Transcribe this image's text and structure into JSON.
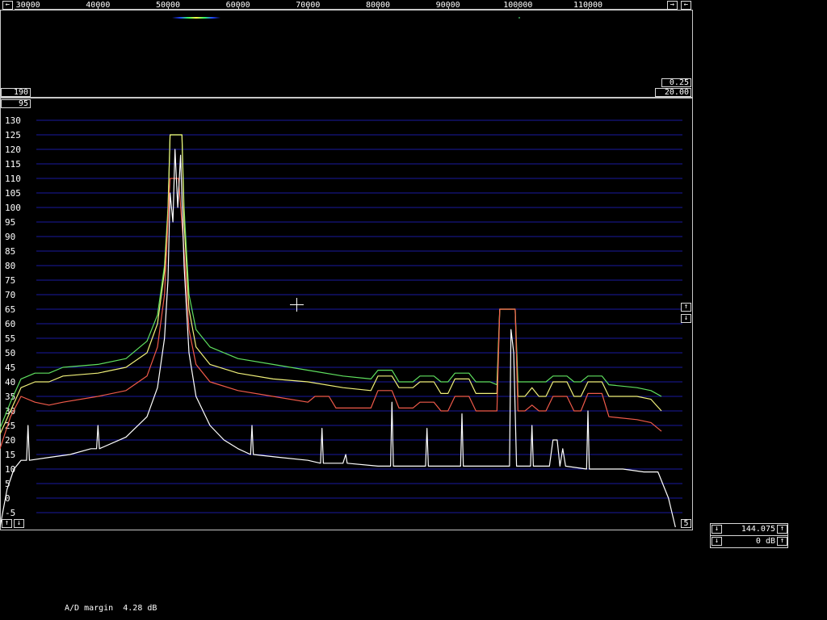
{
  "frequency_scale": {
    "labels": [
      "30000",
      "40000",
      "50000",
      "60000",
      "70000",
      "80000",
      "90000",
      "100000",
      "110000"
    ],
    "left_arrow": "←",
    "right_arrow": "→",
    "right_end_arrow": "←"
  },
  "waterfall": {
    "top_right_value": "0.25",
    "bottom_right_value": "20.00",
    "bottom_left_value": "190"
  },
  "spectrum": {
    "top_left_value": "95",
    "bottom_right_value": "5",
    "bottom_left_up": "↑",
    "bottom_left_down": "↓",
    "side_up": "↑",
    "side_down": "↓",
    "y_labels": [
      "130",
      "125",
      "120",
      "115",
      "110",
      "105",
      "100",
      "95",
      "90",
      "85",
      "80",
      "75",
      "70",
      "65",
      "60",
      "55",
      "50",
      "45",
      "40",
      "35",
      "30",
      "25",
      "20",
      "15",
      "10",
      "5",
      "0",
      "-5"
    ]
  },
  "side_panel": {
    "freq_value": "144.075",
    "gain_value": "0 dB",
    "down_arrow": "↓",
    "up_arrow": "↑"
  },
  "status_bar": {
    "ad_margin_label": "A/D margin",
    "ad_margin_value": "4.28 dB"
  },
  "colors": {
    "grid": "#1a1aa0",
    "green": "#5fe05f",
    "yellow": "#f0f07a",
    "red": "#f05a4a",
    "white": "#ffffff"
  },
  "chart_data": {
    "type": "line",
    "xlim": [
      26000,
      125000
    ],
    "ylim": [
      -10,
      133
    ],
    "y_ticks": [
      130,
      125,
      120,
      115,
      110,
      105,
      100,
      95,
      90,
      85,
      80,
      75,
      70,
      65,
      60,
      55,
      50,
      45,
      40,
      35,
      30,
      25,
      20,
      15,
      10,
      5,
      0,
      -5
    ],
    "series": [
      {
        "color_key": "green",
        "points": [
          [
            26000,
            24
          ],
          [
            27500,
            33
          ],
          [
            29000,
            41
          ],
          [
            31000,
            43
          ],
          [
            33000,
            43
          ],
          [
            35000,
            45
          ],
          [
            40000,
            46
          ],
          [
            44000,
            48
          ],
          [
            47000,
            54
          ],
          [
            48500,
            63
          ],
          [
            49500,
            80
          ],
          [
            50000,
            100
          ],
          [
            50300,
            125
          ],
          [
            52000,
            125
          ],
          [
            52300,
            100
          ],
          [
            53000,
            70
          ],
          [
            54000,
            58
          ],
          [
            56000,
            52
          ],
          [
            60000,
            48
          ],
          [
            65000,
            46
          ],
          [
            70000,
            44
          ],
          [
            75000,
            42
          ],
          [
            79000,
            41
          ],
          [
            80000,
            44
          ],
          [
            82000,
            44
          ],
          [
            83000,
            40
          ],
          [
            85000,
            40
          ],
          [
            86000,
            42
          ],
          [
            88000,
            42
          ],
          [
            89000,
            40
          ],
          [
            90000,
            40
          ],
          [
            91000,
            43
          ],
          [
            93000,
            43
          ],
          [
            94000,
            40
          ],
          [
            96000,
            40
          ],
          [
            97000,
            39
          ],
          [
            97400,
            65
          ],
          [
            99600,
            65
          ],
          [
            100000,
            40
          ],
          [
            101000,
            40
          ],
          [
            102000,
            40
          ],
          [
            103000,
            40
          ],
          [
            104000,
            40
          ],
          [
            105000,
            42
          ],
          [
            107000,
            42
          ],
          [
            108000,
            40
          ],
          [
            109000,
            40
          ],
          [
            110000,
            42
          ],
          [
            112000,
            42
          ],
          [
            113000,
            39
          ],
          [
            117000,
            38
          ],
          [
            119000,
            37
          ],
          [
            120500,
            35
          ]
        ]
      },
      {
        "color_key": "yellow",
        "points": [
          [
            26000,
            22
          ],
          [
            27500,
            30
          ],
          [
            29000,
            38
          ],
          [
            31000,
            40
          ],
          [
            33000,
            40
          ],
          [
            35000,
            42
          ],
          [
            40000,
            43
          ],
          [
            44000,
            45
          ],
          [
            47000,
            50
          ],
          [
            48500,
            60
          ],
          [
            49500,
            78
          ],
          [
            50000,
            98
          ],
          [
            50300,
            125
          ],
          [
            52000,
            125
          ],
          [
            52300,
            95
          ],
          [
            53000,
            65
          ],
          [
            54000,
            52
          ],
          [
            56000,
            46
          ],
          [
            60000,
            43
          ],
          [
            65000,
            41
          ],
          [
            70000,
            40
          ],
          [
            75000,
            38
          ],
          [
            79000,
            37
          ],
          [
            80000,
            42
          ],
          [
            82000,
            42
          ],
          [
            83000,
            38
          ],
          [
            85000,
            38
          ],
          [
            86000,
            40
          ],
          [
            88000,
            40
          ],
          [
            89000,
            36
          ],
          [
            90000,
            36
          ],
          [
            91000,
            41
          ],
          [
            93000,
            41
          ],
          [
            94000,
            36
          ],
          [
            96000,
            36
          ],
          [
            97000,
            36
          ],
          [
            97400,
            65
          ],
          [
            99600,
            65
          ],
          [
            100000,
            35
          ],
          [
            101000,
            35
          ],
          [
            102000,
            38
          ],
          [
            103000,
            35
          ],
          [
            104000,
            35
          ],
          [
            105000,
            40
          ],
          [
            107000,
            40
          ],
          [
            108000,
            35
          ],
          [
            109000,
            35
          ],
          [
            110000,
            40
          ],
          [
            112000,
            40
          ],
          [
            113000,
            35
          ],
          [
            117000,
            35
          ],
          [
            119000,
            34
          ],
          [
            120500,
            30
          ]
        ]
      },
      {
        "color_key": "red",
        "points": [
          [
            26000,
            17
          ],
          [
            27500,
            28
          ],
          [
            29000,
            35
          ],
          [
            31000,
            33
          ],
          [
            33000,
            32
          ],
          [
            35000,
            33
          ],
          [
            40000,
            35
          ],
          [
            44000,
            37
          ],
          [
            47000,
            42
          ],
          [
            48500,
            52
          ],
          [
            49500,
            70
          ],
          [
            50000,
            95
          ],
          [
            50300,
            110
          ],
          [
            51500,
            110
          ],
          [
            52300,
            85
          ],
          [
            53000,
            58
          ],
          [
            54000,
            46
          ],
          [
            56000,
            40
          ],
          [
            60000,
            37
          ],
          [
            65000,
            35
          ],
          [
            70000,
            33
          ],
          [
            71000,
            35
          ],
          [
            73000,
            35
          ],
          [
            74000,
            31
          ],
          [
            79000,
            31
          ],
          [
            80000,
            37
          ],
          [
            82000,
            37
          ],
          [
            83000,
            31
          ],
          [
            85000,
            31
          ],
          [
            86000,
            33
          ],
          [
            88000,
            33
          ],
          [
            89000,
            30
          ],
          [
            90000,
            30
          ],
          [
            91000,
            35
          ],
          [
            93000,
            35
          ],
          [
            94000,
            30
          ],
          [
            96000,
            30
          ],
          [
            97000,
            30
          ],
          [
            97400,
            65
          ],
          [
            99600,
            65
          ],
          [
            100000,
            30
          ],
          [
            101000,
            30
          ],
          [
            102000,
            32
          ],
          [
            103000,
            30
          ],
          [
            104000,
            30
          ],
          [
            105000,
            35
          ],
          [
            107000,
            35
          ],
          [
            108000,
            30
          ],
          [
            109000,
            30
          ],
          [
            110000,
            36
          ],
          [
            112000,
            36
          ],
          [
            113000,
            28
          ],
          [
            117000,
            27
          ],
          [
            119000,
            26
          ],
          [
            120500,
            23
          ]
        ]
      },
      {
        "color_key": "white",
        "points": [
          [
            26000,
            -10
          ],
          [
            27000,
            3
          ],
          [
            28000,
            10
          ],
          [
            29000,
            13
          ],
          [
            29800,
            13
          ],
          [
            30000,
            25
          ],
          [
            30200,
            13
          ],
          [
            33000,
            14
          ],
          [
            36000,
            15
          ],
          [
            39000,
            17
          ],
          [
            39800,
            17
          ],
          [
            40000,
            25
          ],
          [
            40200,
            17
          ],
          [
            44000,
            21
          ],
          [
            47000,
            28
          ],
          [
            48500,
            38
          ],
          [
            49500,
            55
          ],
          [
            50000,
            75
          ],
          [
            50300,
            105
          ],
          [
            50700,
            95
          ],
          [
            51000,
            120
          ],
          [
            51400,
            100
          ],
          [
            51800,
            118
          ],
          [
            52300,
            80
          ],
          [
            53000,
            50
          ],
          [
            54000,
            35
          ],
          [
            56000,
            25
          ],
          [
            58000,
            20
          ],
          [
            60000,
            17
          ],
          [
            61800,
            15
          ],
          [
            62000,
            25
          ],
          [
            62200,
            15
          ],
          [
            66000,
            14
          ],
          [
            70000,
            13
          ],
          [
            71800,
            12
          ],
          [
            72000,
            24
          ],
          [
            72200,
            12
          ],
          [
            75000,
            12
          ],
          [
            75400,
            15
          ],
          [
            75600,
            12
          ],
          [
            80000,
            11
          ],
          [
            81800,
            11
          ],
          [
            82000,
            33
          ],
          [
            82200,
            11
          ],
          [
            86800,
            11
          ],
          [
            87000,
            24
          ],
          [
            87200,
            11
          ],
          [
            91800,
            11
          ],
          [
            92000,
            29
          ],
          [
            92200,
            11
          ],
          [
            97000,
            11
          ],
          [
            98800,
            11
          ],
          [
            99000,
            58
          ],
          [
            99400,
            50
          ],
          [
            99800,
            11
          ],
          [
            101800,
            11
          ],
          [
            102000,
            25
          ],
          [
            102200,
            11
          ],
          [
            104500,
            11
          ],
          [
            105000,
            20
          ],
          [
            105600,
            20
          ],
          [
            106000,
            11
          ],
          [
            106400,
            17
          ],
          [
            106800,
            11
          ],
          [
            109800,
            10
          ],
          [
            110000,
            30
          ],
          [
            110200,
            10
          ],
          [
            115000,
            10
          ],
          [
            118000,
            9
          ],
          [
            120000,
            9
          ],
          [
            121500,
            0
          ],
          [
            122500,
            -10
          ]
        ]
      }
    ]
  }
}
